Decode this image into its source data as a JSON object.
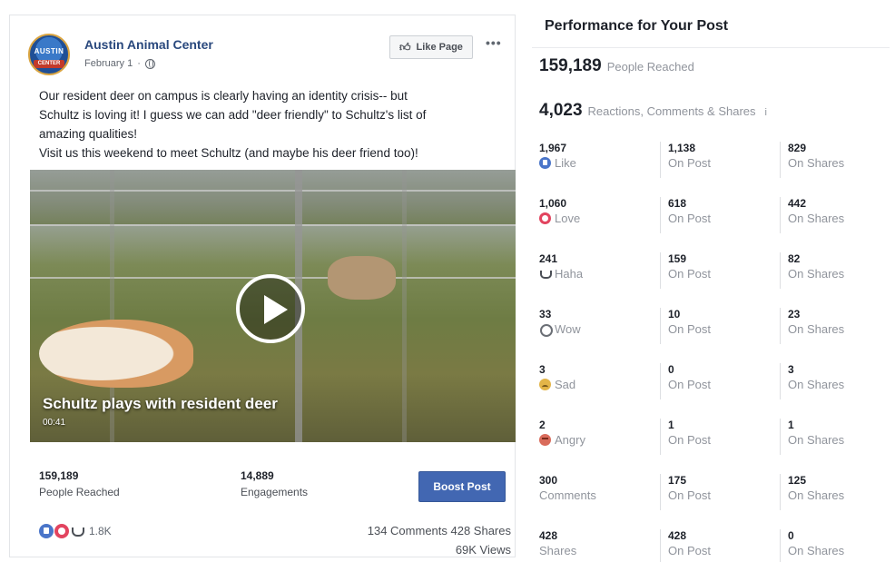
{
  "post": {
    "page_name": "Austin Animal Center",
    "date": "February 1",
    "avatar_text": "AUSTIN",
    "avatar_band_text": "CENTER",
    "like_page_label": "Like Page",
    "more_label": "•••",
    "text_lines": [
      "Our resident deer on campus is clearly having an identity crisis-- but",
      "Schultz is loving it! I guess we can add \"deer friendly\" to Schultz's list of",
      "amazing qualities!",
      "Visit us this weekend to meet Schultz (and maybe his deer friend too)!"
    ],
    "video": {
      "title": "Schultz plays with resident deer",
      "duration": "00:41"
    },
    "stats": {
      "people_reached_value": "159,189",
      "people_reached_label": "People Reached",
      "engagements_value": "14,889",
      "engagements_label": "Engagements",
      "boost_label": "Boost Post"
    },
    "footer": {
      "reactions_total": "1.8K",
      "comments_shares": "134 Comments  428 Shares",
      "views": "69K Views"
    }
  },
  "performance": {
    "title": "Performance for Your Post",
    "people_reached_value": "159,189",
    "people_reached_label": "People Reached",
    "reactions_value": "4,023",
    "reactions_label": "Reactions, Comments & Shares",
    "info_icon": "i",
    "rows": [
      {
        "icon": "like-icon",
        "total": "1,967",
        "label": "Like",
        "on_post": "1,138",
        "on_post_label": "On Post",
        "on_shares": "829",
        "on_shares_label": "On Shares"
      },
      {
        "icon": "love-icon",
        "total": "1,060",
        "label": "Love",
        "on_post": "618",
        "on_post_label": "On Post",
        "on_shares": "442",
        "on_shares_label": "On Shares"
      },
      {
        "icon": "haha-icon",
        "total": "241",
        "label": "Haha",
        "on_post": "159",
        "on_post_label": "On Post",
        "on_shares": "82",
        "on_shares_label": "On Shares"
      },
      {
        "icon": "wow-icon",
        "total": "33",
        "label": "Wow",
        "on_post": "10",
        "on_post_label": "On Post",
        "on_shares": "23",
        "on_shares_label": "On Shares"
      },
      {
        "icon": "sad-icon",
        "total": "3",
        "label": "Sad",
        "on_post": "0",
        "on_post_label": "On Post",
        "on_shares": "3",
        "on_shares_label": "On Shares"
      },
      {
        "icon": "angry-icon",
        "total": "2",
        "label": "Angry",
        "on_post": "1",
        "on_post_label": "On Post",
        "on_shares": "1",
        "on_shares_label": "On Shares"
      },
      {
        "icon": "",
        "total": "300",
        "label": "Comments",
        "on_post": "175",
        "on_post_label": "On Post",
        "on_shares": "125",
        "on_shares_label": "On Shares"
      },
      {
        "icon": "",
        "total": "428",
        "label": "Shares",
        "on_post": "428",
        "on_post_label": "On Post",
        "on_shares": "0",
        "on_shares_label": "On Shares"
      }
    ]
  },
  "colors": {
    "brand_blue": "#4267b2",
    "page_name_blue": "#29487d",
    "like_blue": "#4a75c9",
    "love_red": "#e2445f",
    "muted_text": "#90949c"
  }
}
